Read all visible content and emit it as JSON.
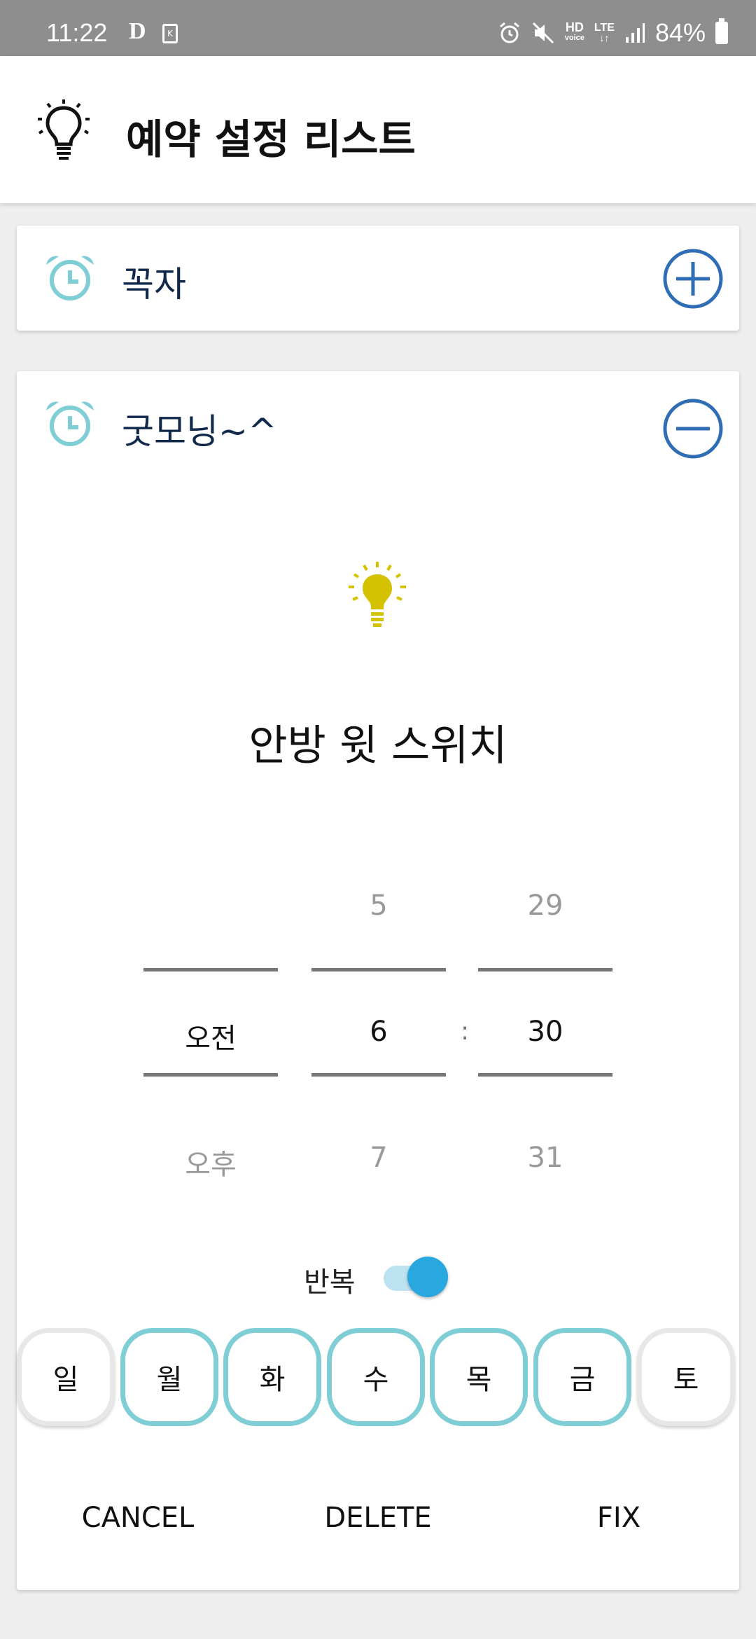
{
  "status_bar": {
    "time": "11:22",
    "d_indicator": "D",
    "hd_label": "HD",
    "voice_label": "voice",
    "lte_label": "LTE",
    "battery": "84%"
  },
  "app_bar": {
    "title": "예약 설정 리스트"
  },
  "reservations": [
    {
      "title": "꼭자",
      "action_icon": "plus-circle-icon"
    },
    {
      "title": "굿모닝~^",
      "action_icon": "minus-circle-icon"
    }
  ],
  "editor": {
    "device_name": "안방 윗 스위치",
    "time_picker": {
      "period": {
        "prev": "",
        "current": "오전",
        "next": "오후"
      },
      "hour": {
        "prev": "5",
        "current": "6",
        "next": "7"
      },
      "separator": ":",
      "minute": {
        "prev": "29",
        "current": "30",
        "next": "31"
      }
    },
    "repeat": {
      "label": "반복",
      "enabled": true
    },
    "days": [
      {
        "label": "일",
        "selected": false
      },
      {
        "label": "월",
        "selected": true
      },
      {
        "label": "화",
        "selected": true
      },
      {
        "label": "수",
        "selected": true
      },
      {
        "label": "목",
        "selected": true
      },
      {
        "label": "금",
        "selected": true
      },
      {
        "label": "토",
        "selected": false
      }
    ],
    "actions": {
      "cancel": "CANCEL",
      "delete": "DELETE",
      "fix": "FIX"
    }
  },
  "colors": {
    "accent_blue": "#2f6db5",
    "alarm_teal": "#7fcdd5",
    "bulb_yellow": "#d4c200",
    "toggle_blue": "#29a8e0"
  }
}
